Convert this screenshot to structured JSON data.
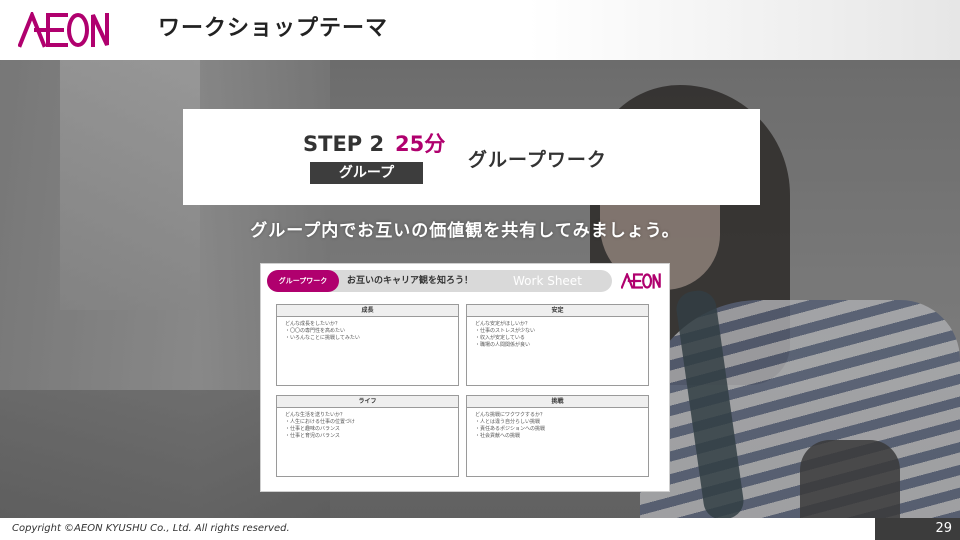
{
  "header": {
    "title": "ワークショップテーマ",
    "brand_color": "#b0006e"
  },
  "step": {
    "label": "STEP 2",
    "time": "25分",
    "badge": "グループ",
    "name": "グループワーク"
  },
  "instruction": "グループ内でお互いの価値観を共有してみましょう。",
  "worksheet": {
    "pill": "グループワーク",
    "title": "お互いのキャリア観を知ろう！",
    "subtitle": "Work Sheet",
    "cells": [
      {
        "head": "成長",
        "lines": [
          "どんな成長をしたいか？",
          "・〇〇の専門性を高めたい",
          "・いろんなことに挑戦してみたい"
        ]
      },
      {
        "head": "安定",
        "lines": [
          "どんな安定がほしいか？",
          "・仕事のストレスが少ない",
          "・収入が安定している",
          "・職場の人間関係が良い"
        ]
      },
      {
        "head": "ライフ",
        "lines": [
          "どんな生活を送りたいか？",
          "・人生における仕事の位置づけ",
          "・仕事と趣味のバランス",
          "・仕事と育児のバランス"
        ]
      },
      {
        "head": "挑戦",
        "lines": [
          "どんな挑戦にワクワクするか？",
          "・人とは違う自分らしい挑戦",
          "・責任あるポジションへの挑戦",
          "・社会貢献への挑戦"
        ]
      }
    ]
  },
  "footer": {
    "copyright": "Copyright ©AEON KYUSHU Co., Ltd. All rights reserved.",
    "page": "29"
  }
}
